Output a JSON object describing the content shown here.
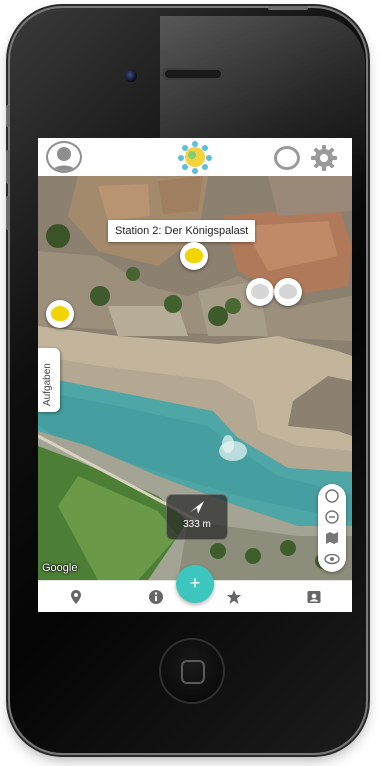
{
  "map": {
    "station_label": "Station 2: Der Königspalast",
    "side_tab_label": "Aufgaben",
    "distance": "333 m",
    "attribution": "Google"
  },
  "fab": {
    "label": "+"
  },
  "icons": {
    "header": [
      "user-avatar-icon",
      "app-logo",
      "circle-icon",
      "gear-icon"
    ],
    "map_controls": [
      "locate-icon",
      "zoom-icon",
      "map-layer-icon",
      "eye-icon"
    ],
    "tabbar": [
      "location-pin-icon",
      "info-icon",
      "star-icon",
      "contact-card-icon"
    ]
  },
  "colors": {
    "accent": "#3cc6bd",
    "marker_yellow": "#f2d400",
    "water": "#4fa6a7"
  }
}
